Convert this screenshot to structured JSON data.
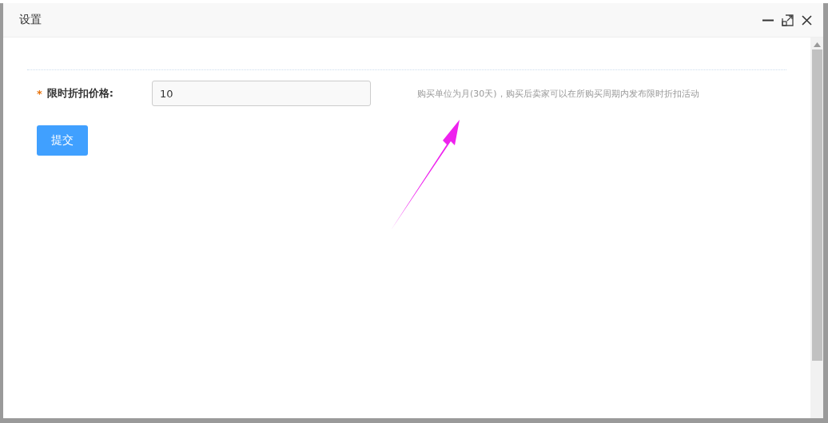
{
  "window": {
    "title": "设置"
  },
  "form": {
    "label": "限时折扣价格:",
    "required_mark": "*",
    "value": "10",
    "hint": "购买单位为月(30天)，购买后卖家可以在所购买周期内发布限时折扣活动"
  },
  "buttons": [
    "提交"
  ]
}
